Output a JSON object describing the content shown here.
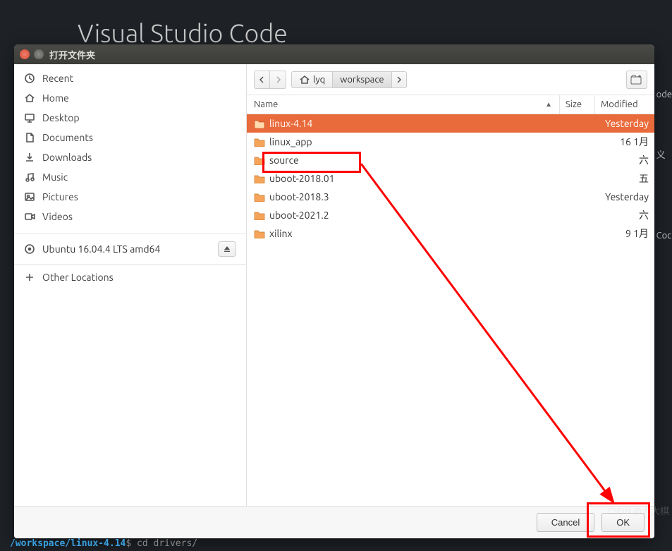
{
  "background": {
    "app_title": "Visual Studio Code"
  },
  "dialog": {
    "title": "打开文件夹",
    "sidebar": {
      "items": [
        {
          "icon": "recent",
          "label": "Recent"
        },
        {
          "icon": "home",
          "label": "Home"
        },
        {
          "icon": "desktop",
          "label": "Desktop"
        },
        {
          "icon": "documents",
          "label": "Documents"
        },
        {
          "icon": "downloads",
          "label": "Downloads"
        },
        {
          "icon": "music",
          "label": "Music"
        },
        {
          "icon": "pictures",
          "label": "Pictures"
        },
        {
          "icon": "videos",
          "label": "Videos"
        }
      ],
      "mount": {
        "icon": "disk",
        "label": "Ubuntu 16.04.4 LTS amd64"
      },
      "other": {
        "icon": "plus",
        "label": "Other Locations"
      }
    },
    "pathbar": {
      "crumbs": [
        "lyq",
        "workspace"
      ]
    },
    "columns": {
      "name": "Name",
      "size": "Size",
      "modified": "Modified"
    },
    "files": [
      {
        "name": "linux-4.14",
        "size": "",
        "modified": "Yesterday",
        "selected": true
      },
      {
        "name": "linux_app",
        "size": "",
        "modified": "16 1月",
        "selected": false
      },
      {
        "name": "source",
        "size": "",
        "modified": "六",
        "selected": false
      },
      {
        "name": "uboot-2018.01",
        "size": "",
        "modified": "五",
        "selected": false
      },
      {
        "name": "uboot-2018.3",
        "size": "",
        "modified": "Yesterday",
        "selected": false
      },
      {
        "name": "uboot-2021.2",
        "size": "",
        "modified": "六",
        "selected": false
      },
      {
        "name": "xilinx",
        "size": "",
        "modified": "9 1月",
        "selected": false
      }
    ],
    "buttons": {
      "cancel": "Cancel",
      "ok": "OK"
    }
  },
  "side_partial": [
    "ode",
    "义",
    "Coc"
  ],
  "watermark": "CSDN @大大棋",
  "terminal": {
    "path": "/workspace/linux-4.14",
    "cmd": "$ cd drivers/"
  }
}
